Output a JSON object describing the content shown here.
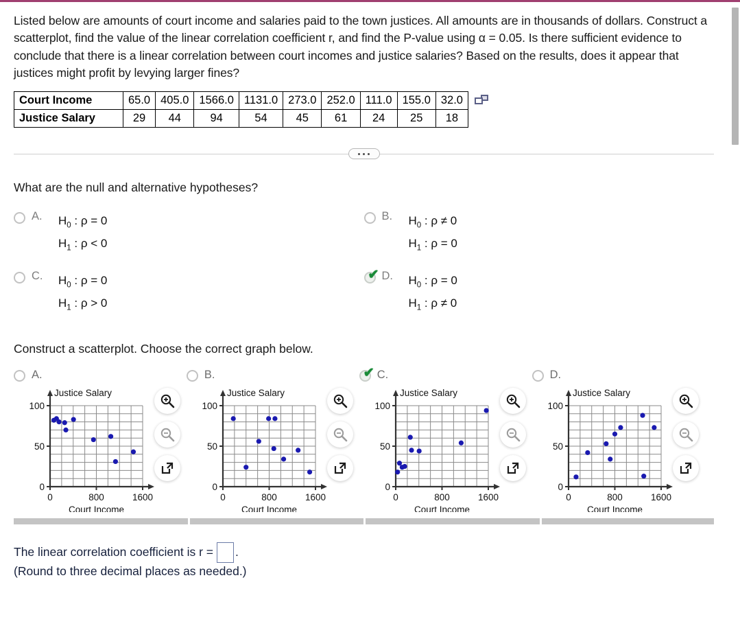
{
  "statement": {
    "paragraph": "Listed below are amounts of court income and salaries paid to the town justices. All amounts are in thousands of dollars. Construct a scatterplot, find the value of the linear correlation coefficient r, and find the P-value using α = 0.05. Is there sufficient evidence to conclude that there is a linear correlation between court incomes and justice salaries? Based on the results, does it appear that justices might profit by levying larger fines?"
  },
  "data_table": {
    "rows": [
      {
        "label": "Court Income",
        "values": [
          "65.0",
          "405.0",
          "1566.0",
          "1131.0",
          "273.0",
          "252.0",
          "111.0",
          "155.0",
          "32.0"
        ]
      },
      {
        "label": "Justice Salary",
        "values": [
          "29",
          "44",
          "94",
          "54",
          "45",
          "61",
          "24",
          "25",
          "18"
        ]
      }
    ],
    "copy_icon": "copy-icon"
  },
  "divider": {
    "icon": "ellipsis-icon"
  },
  "question1": {
    "prompt": "What are the null and alternative hypotheses?",
    "options": [
      {
        "letter": "A.",
        "null": "H₀: ρ = 0",
        "alt": "H₁: ρ < 0",
        "selected": false
      },
      {
        "letter": "B.",
        "null": "H₀: ρ ≠ 0",
        "alt": "H₁: ρ = 0",
        "selected": false
      },
      {
        "letter": "C.",
        "null": "H₀: ρ = 0",
        "alt": "H₁: ρ > 0",
        "selected": false
      },
      {
        "letter": "D.",
        "null": "H₀: ρ = 0",
        "alt": "H₁: ρ ≠ 0",
        "selected": true
      }
    ]
  },
  "question2": {
    "prompt": "Construct a scatterplot. Choose the correct graph below.",
    "options": [
      {
        "letter": "A.",
        "selected": false
      },
      {
        "letter": "B.",
        "selected": false
      },
      {
        "letter": "C.",
        "selected": true
      },
      {
        "letter": "D.",
        "selected": false
      }
    ],
    "tools": [
      {
        "name": "zoom-in-icon",
        "state": "enabled"
      },
      {
        "name": "zoom-out-icon",
        "state": "disabled"
      },
      {
        "name": "pop-out-icon",
        "state": "enabled"
      }
    ]
  },
  "answer": {
    "prefix": "The linear correlation coefficient is r =",
    "suffix": ".",
    "value": "",
    "placeholder": "",
    "rounding_note": "(Round to three decimal places as needed.)"
  },
  "colors": {
    "top_border": "#a04070",
    "point": "#1a1ab0",
    "grid": "#8a8a8a",
    "axis": "#333333",
    "check": "#1a8a38",
    "scrollbar": "#c4c4c4"
  },
  "chart_data": [
    {
      "type": "scatter",
      "title": "A.",
      "xlabel": "Court Income",
      "ylabel": "Justice Salary",
      "xlim": [
        0,
        1600
      ],
      "ylim": [
        0,
        100
      ],
      "xticks": [
        0,
        800,
        1600
      ],
      "yticks": [
        0,
        50,
        100
      ],
      "grid": true,
      "x": [
        65,
        111,
        155,
        252,
        273,
        405,
        750,
        1050,
        1131,
        1440
      ],
      "y": [
        82,
        84,
        80,
        79,
        70,
        83,
        58,
        62,
        31,
        43
      ]
    },
    {
      "type": "scatter",
      "title": "B.",
      "xlabel": "Court Income",
      "ylabel": "Justice Salary",
      "xlim": [
        0,
        1600
      ],
      "ylim": [
        0,
        100
      ],
      "xticks": [
        0,
        800,
        1600
      ],
      "yticks": [
        0,
        50,
        100
      ],
      "grid": true,
      "x": [
        180,
        400,
        620,
        790,
        880,
        900,
        1050,
        1300,
        1500
      ],
      "y": [
        84,
        24,
        56,
        84,
        47,
        84,
        34,
        45,
        18
      ]
    },
    {
      "type": "scatter",
      "title": "C.",
      "xlabel": "Court Income",
      "ylabel": "Justice Salary",
      "xlim": [
        0,
        1600
      ],
      "ylim": [
        0,
        100
      ],
      "xticks": [
        0,
        800,
        1600
      ],
      "yticks": [
        0,
        50,
        100
      ],
      "grid": true,
      "x": [
        32,
        65,
        111,
        155,
        252,
        273,
        405,
        1131,
        1566
      ],
      "y": [
        18,
        29,
        24,
        25,
        61,
        45,
        44,
        54,
        94
      ]
    },
    {
      "type": "scatter",
      "title": "D.",
      "xlabel": "Court Income",
      "ylabel": "Justice Salary",
      "xlim": [
        0,
        1600
      ],
      "ylim": [
        0,
        100
      ],
      "xticks": [
        0,
        800,
        1600
      ],
      "yticks": [
        0,
        50,
        100
      ],
      "grid": true,
      "x": [
        130,
        330,
        650,
        720,
        800,
        900,
        1280,
        1300,
        1480
      ],
      "y": [
        12,
        42,
        53,
        34,
        65,
        73,
        88,
        13,
        73
      ]
    }
  ]
}
